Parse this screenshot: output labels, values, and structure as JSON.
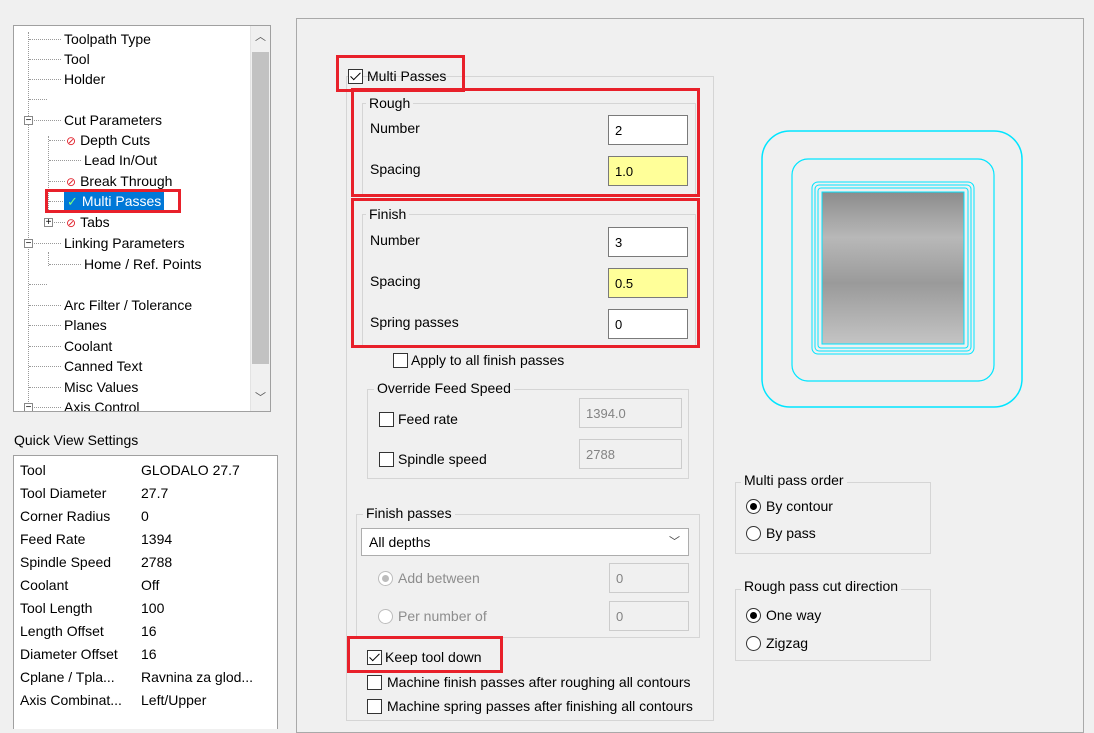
{
  "tree": {
    "items": [
      {
        "label": "Toolpath Type"
      },
      {
        "label": "Tool"
      },
      {
        "label": "Holder"
      },
      {
        "label": ""
      },
      {
        "label": "Cut Parameters"
      },
      {
        "label": "Depth Cuts"
      },
      {
        "label": "Lead In/Out"
      },
      {
        "label": "Break Through"
      },
      {
        "label": "Multi Passes"
      },
      {
        "label": "Tabs"
      },
      {
        "label": "Linking Parameters"
      },
      {
        "label": "Home / Ref. Points"
      },
      {
        "label": ""
      },
      {
        "label": "Arc Filter / Tolerance"
      },
      {
        "label": "Planes"
      },
      {
        "label": "Coolant"
      },
      {
        "label": "Canned Text"
      },
      {
        "label": "Misc Values"
      },
      {
        "label": "Axis Control"
      }
    ]
  },
  "quick_view": {
    "title": "Quick View Settings",
    "rows": [
      {
        "key": "Tool",
        "value": "GLODALO 27.7"
      },
      {
        "key": "Tool Diameter",
        "value": "27.7"
      },
      {
        "key": "Corner Radius",
        "value": "0"
      },
      {
        "key": "Feed Rate",
        "value": "1394"
      },
      {
        "key": "Spindle Speed",
        "value": "2788"
      },
      {
        "key": "Coolant",
        "value": "Off"
      },
      {
        "key": "Tool Length",
        "value": "100"
      },
      {
        "key": "Length Offset",
        "value": "16"
      },
      {
        "key": "Diameter Offset",
        "value": "16"
      },
      {
        "key": "Cplane / Tpla...",
        "value": "Ravnina za glod..."
      },
      {
        "key": "Axis Combinat...",
        "value": "Left/Upper"
      }
    ]
  },
  "multi_passes": {
    "label": "Multi Passes",
    "checked": true,
    "rough": {
      "title": "Rough",
      "number_label": "Number",
      "number_value": "2",
      "spacing_label": "Spacing",
      "spacing_value": "1.0"
    },
    "finish": {
      "title": "Finish",
      "number_label": "Number",
      "number_value": "3",
      "spacing_label": "Spacing",
      "spacing_value": "0.5",
      "spring_label": "Spring passes",
      "spring_value": "0"
    },
    "apply_all_label": "Apply to all finish passes",
    "override": {
      "title": "Override Feed Speed",
      "feed_label": "Feed rate",
      "feed_value": "1394.0",
      "spindle_label": "Spindle speed",
      "spindle_value": "2788"
    },
    "finish_passes": {
      "title": "Finish passes",
      "selected": "All depths",
      "add_between_label": "Add between",
      "add_between_value": "0",
      "per_number_label": "Per number of",
      "per_number_value": "0"
    },
    "keep_tool_down_label": "Keep tool down",
    "machine_finish_label": "Machine finish passes after roughing all contours",
    "machine_spring_label": "Machine spring passes after finishing all contours",
    "pass_order": {
      "title": "Multi pass order",
      "by_contour": "By contour",
      "by_pass": "By pass"
    },
    "rough_direction": {
      "title": "Rough pass cut direction",
      "one_way": "One way",
      "zigzag": "Zigzag"
    }
  },
  "colors": {
    "highlight_red": "#e8202a",
    "selection_blue": "#0078d7",
    "preview_cyan": "#00e5ff",
    "yellow_field": "#ffff99"
  }
}
